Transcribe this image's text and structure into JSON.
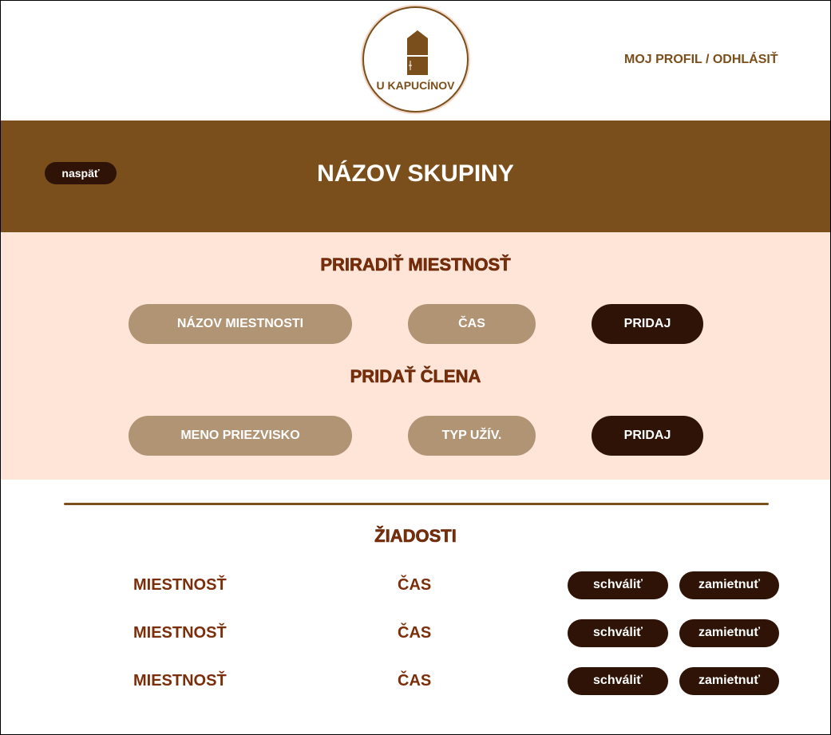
{
  "header": {
    "logo_text": "U KAPUCÍNOV",
    "profile_link": "MOJ PROFIL / ODHLÁSIŤ"
  },
  "banner": {
    "back_label": "naspäť",
    "title": "NÁZOV SKUPINY"
  },
  "assign_room": {
    "title": "PRIRADIŤ MIESTNOSŤ",
    "room_field": "NÁZOV MIESTNOSTI",
    "time_field": "ČAS",
    "add_label": "PRIDAJ"
  },
  "add_member": {
    "title": "PRIDAŤ ČLENA",
    "name_field": "MENO PRIEZVISKO",
    "type_field": "TYP UŽÍV.",
    "add_label": "PRIDAJ"
  },
  "requests": {
    "title": "ŽIADOSTI",
    "rows": [
      {
        "room": "MIESTNOSŤ",
        "time": "ČAS",
        "approve": "schváliť",
        "reject": "zamietnuť"
      },
      {
        "room": "MIESTNOSŤ",
        "time": "ČAS",
        "approve": "schváliť",
        "reject": "zamietnuť"
      },
      {
        "room": "MIESTNOSŤ",
        "time": "ČAS",
        "approve": "schváliť",
        "reject": "zamietnuť"
      }
    ]
  },
  "colors": {
    "brand_brown": "#7a4f1b",
    "dark_button": "#2e1306",
    "field_tan": "#b09474",
    "peach_bg": "#fee5d8",
    "heading_red_brown": "#7a2e09"
  }
}
